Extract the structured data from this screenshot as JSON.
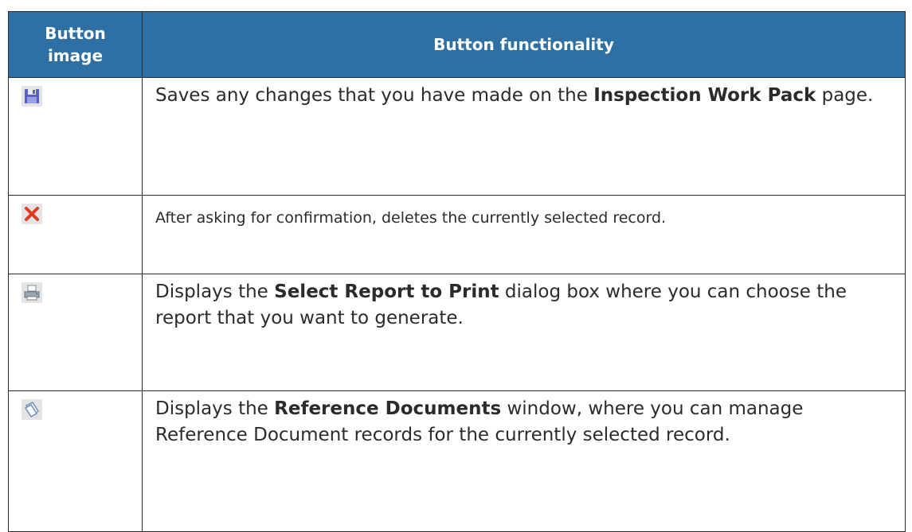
{
  "header": {
    "col1": "Button image",
    "col2": "Button functionality"
  },
  "rows": [
    {
      "icon": "save-icon",
      "t1": "Saves any changes that you have made on the ",
      "b1": "Inspection Work Pack",
      "t2": " page.",
      "b2": "",
      "t3": ""
    },
    {
      "icon": "delete-icon",
      "t1": "After asking for confirmation, deletes the currently selected record.",
      "b1": "",
      "t2": "",
      "b2": "",
      "t3": ""
    },
    {
      "icon": "print-icon",
      "t1": "Displays the ",
      "b1": "Select Report to Print",
      "t2": " dialog box where you can choose the report that you want to generate.",
      "b2": "",
      "t3": ""
    },
    {
      "icon": "reference-documents-icon",
      "t1": "Displays the ",
      "b1": "Reference Documents",
      "t2": " window, where you can manage Reference Document records for the currently selected record.",
      "b2": "",
      "t3": ""
    }
  ]
}
